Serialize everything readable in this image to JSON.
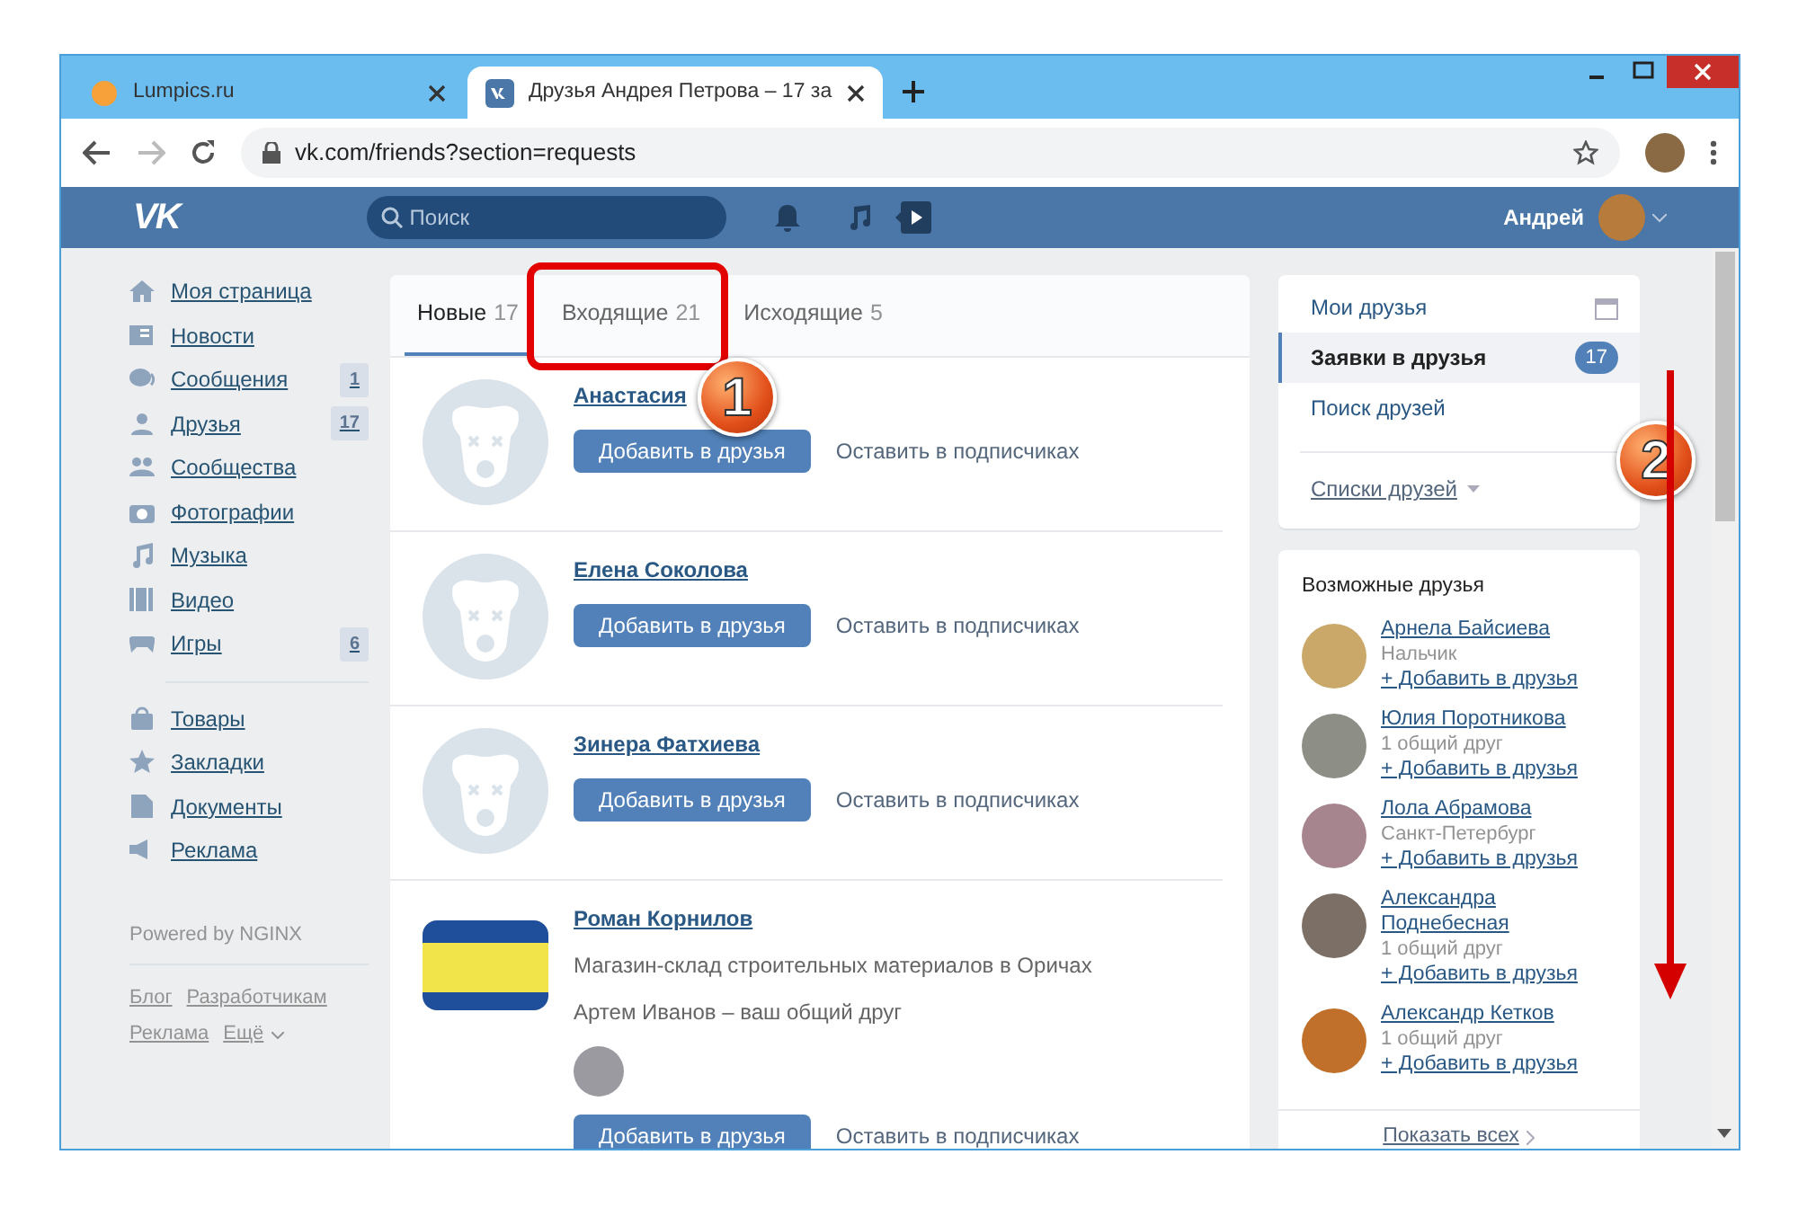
{
  "browser": {
    "tabs": [
      {
        "title": "Lumpics.ru",
        "selected": false
      },
      {
        "title": "Друзья Андрея Петрова – 17 за",
        "selected": true
      }
    ],
    "address": "vk.com/friends?section=requests",
    "forward_disabled": true
  },
  "header": {
    "logo": "VK",
    "search_placeholder": "Поиск",
    "user_name": "Андрей"
  },
  "sidebar": {
    "items": [
      {
        "label": "Моя страница"
      },
      {
        "label": "Новости"
      },
      {
        "label": "Сообщения",
        "count": "1"
      },
      {
        "label": "Друзья",
        "count": "17"
      },
      {
        "label": "Сообщества"
      },
      {
        "label": "Фотографии"
      },
      {
        "label": "Музыка"
      },
      {
        "label": "Видео"
      },
      {
        "label": "Игры",
        "count": "6"
      }
    ],
    "items2": [
      {
        "label": "Товары"
      },
      {
        "label": "Закладки"
      },
      {
        "label": "Документы"
      },
      {
        "label": "Реклама"
      }
    ],
    "powered": "Powered by NGINX",
    "footer_links": [
      "Блог",
      "Разработчикам",
      "Реклама",
      "Ещё"
    ]
  },
  "tabs": [
    {
      "label": "Новые",
      "count": "17",
      "selected": true
    },
    {
      "label": "Входящие",
      "count": "21",
      "selected": false
    },
    {
      "label": "Исходящие",
      "count": "5",
      "selected": false
    }
  ],
  "requests": [
    {
      "name": "Анастасия",
      "kind": "placeholder",
      "add": "Добавить в друзья",
      "keep": "Оставить в подписчиках"
    },
    {
      "name": "Елена Соколова",
      "kind": "placeholder",
      "add": "Добавить в друзья",
      "keep": "Оставить в подписчиках"
    },
    {
      "name": "Зинера Фатхиева",
      "kind": "placeholder",
      "add": "Добавить в друзья",
      "keep": "Оставить в подписчиках"
    },
    {
      "name": "Роман Корнилов",
      "kind": "photo",
      "description": "Магазин-склад строительных материалов в Оричах",
      "mutual": "Артем Иванов – ваш общий друг",
      "add": "Добавить в друзья",
      "keep": "Оставить в подписчиках"
    }
  ],
  "right_menu": [
    {
      "label": "Мои друзья",
      "selected": false
    },
    {
      "label": "Заявки в друзья",
      "selected": true,
      "count": "17"
    },
    {
      "label": "Поиск друзей",
      "selected": false
    }
  ],
  "lists_label": "Списки друзей",
  "possible": {
    "title": "Возможные друзья",
    "people": [
      {
        "name": "Арнела Байсиева",
        "info": "Нальчик",
        "add": "+ Добавить в друзья",
        "color": "#c9a86a"
      },
      {
        "name": "Юлия Поротникова",
        "info": "1 общий друг",
        "add": "+ Добавить в друзья",
        "color": "#8d8f86"
      },
      {
        "name": "Лола Абрамова",
        "info": "Санкт-Петербург",
        "add": "+ Добавить в друзья",
        "color": "#a6858f"
      },
      {
        "name": "Александра Поднебесная",
        "info": "1 общий друг",
        "add": "+ Добавить в друзья",
        "color": "#7b6f66"
      },
      {
        "name": "Александр Кетков",
        "info": "1 общий друг",
        "add": "+ Добавить в друзья",
        "color": "#c0702a"
      }
    ],
    "show_all": "Показать всех"
  },
  "annotations": [
    {
      "label": "1"
    },
    {
      "label": "2"
    }
  ]
}
